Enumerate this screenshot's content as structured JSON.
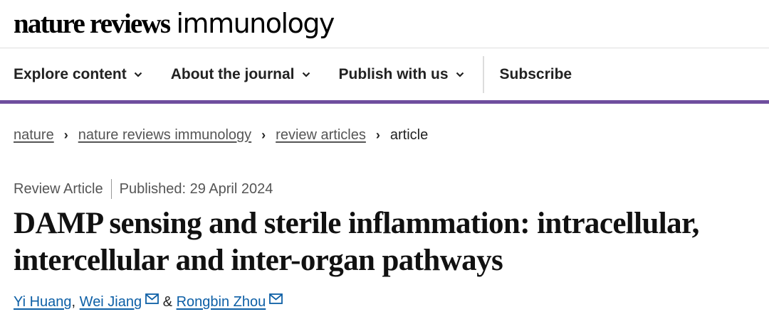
{
  "masthead": {
    "logo_bold": "nature reviews",
    "logo_light": "immunology"
  },
  "nav": {
    "items": [
      {
        "label": "Explore content"
      },
      {
        "label": "About the journal"
      },
      {
        "label": "Publish with us"
      }
    ],
    "subscribe_label": "Subscribe"
  },
  "breadcrumb": {
    "items": [
      {
        "label": "nature"
      },
      {
        "label": "nature reviews immunology"
      },
      {
        "label": "review articles"
      }
    ],
    "current": "article"
  },
  "article": {
    "type": "Review Article",
    "published": "Published: 29 April 2024",
    "title": "DAMP sensing and sterile inflammation: intracellular, intercellular and inter-organ pathways",
    "authors": [
      {
        "name": "Yi Huang",
        "email_icon": false
      },
      {
        "name": "Wei Jiang",
        "email_icon": true
      },
      {
        "name": "Rongbin Zhou",
        "email_icon": true
      }
    ],
    "author_separators": [
      ",",
      "&"
    ]
  },
  "colors": {
    "accent": "#6f4e9e",
    "link": "#0d5fa6",
    "text": "#222222"
  }
}
